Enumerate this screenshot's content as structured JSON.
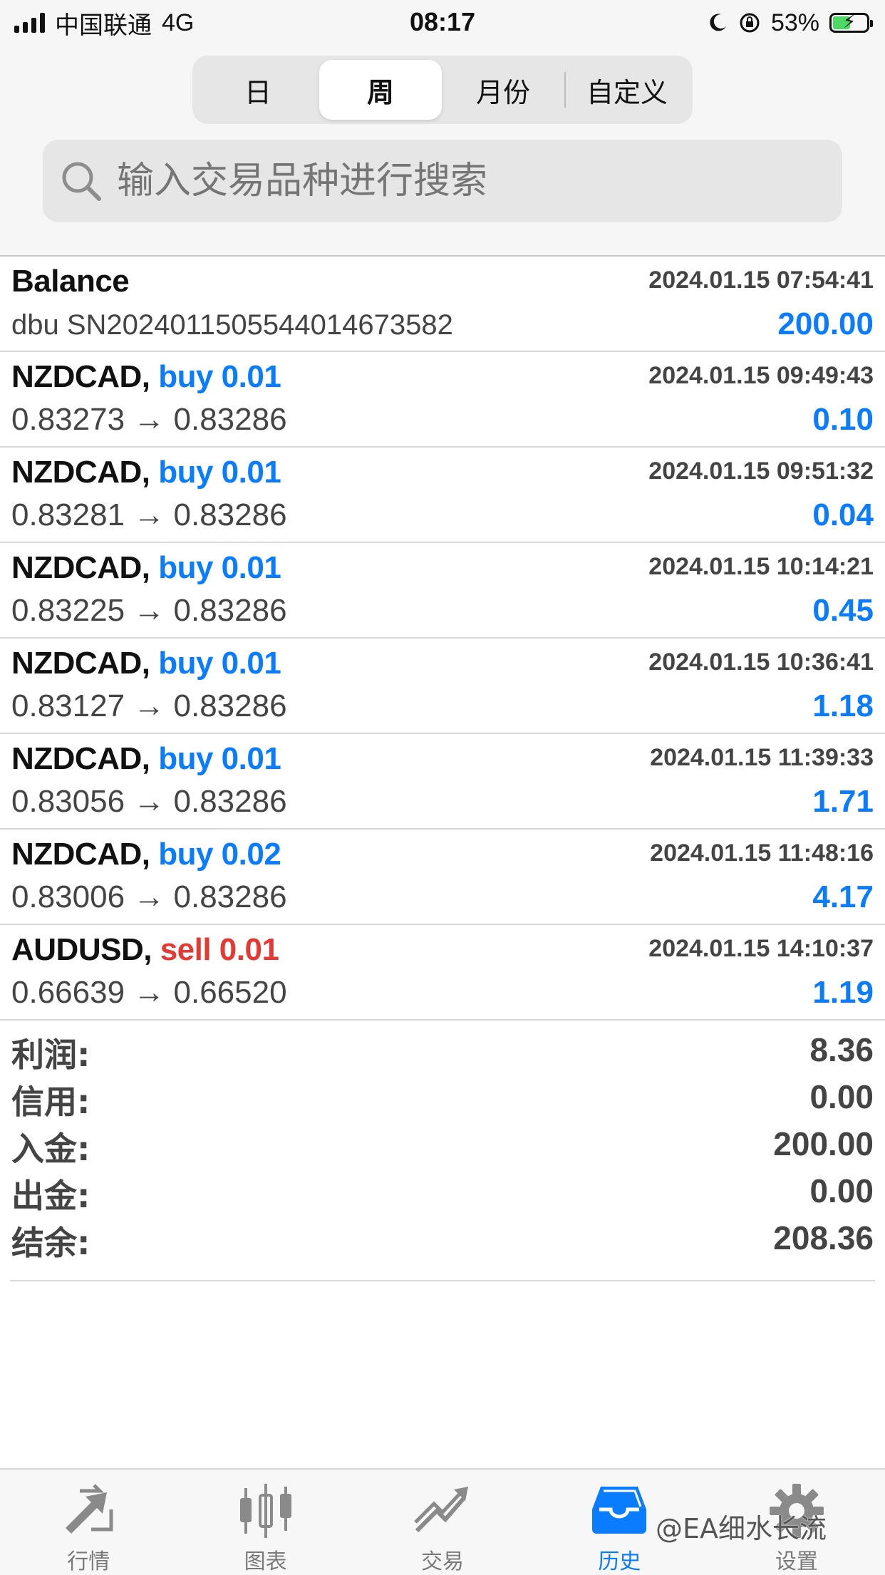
{
  "status_bar": {
    "carrier": "中国联通",
    "network": "4G",
    "time": "08:17",
    "battery": "53%",
    "battery_level": 0.53
  },
  "segments": {
    "items": [
      "日",
      "周",
      "月份",
      "自定义"
    ],
    "selected": "周"
  },
  "search": {
    "placeholder": "输入交易品种进行搜索"
  },
  "balance_row": {
    "title": "Balance",
    "time": "2024.01.15 07:54:41",
    "comment": "dbu SN20240115055440146735​82",
    "amount": "200.00"
  },
  "trades": [
    {
      "symbol": "NZDCAD,",
      "side": "buy 0.01",
      "time": "2024.01.15 09:49:43",
      "prices": "0.83273 → 0.83286",
      "profit": "0.10"
    },
    {
      "symbol": "NZDCAD,",
      "side": "buy 0.01",
      "time": "2024.01.15 09:51:32",
      "prices": "0.83281 → 0.83286",
      "profit": "0.04"
    },
    {
      "symbol": "NZDCAD,",
      "side": "buy 0.01",
      "time": "2024.01.15 10:14:21",
      "prices": "0.83225 → 0.83286",
      "profit": "0.45"
    },
    {
      "symbol": "NZDCAD,",
      "side": "buy 0.01",
      "time": "2024.01.15 10:36:41",
      "prices": "0.83127 → 0.83286",
      "profit": "1.18"
    },
    {
      "symbol": "NZDCAD,",
      "side": "buy 0.01",
      "time": "2024.01.15 11:39:33",
      "prices": "0.83056 → 0.83286",
      "profit": "1.71"
    },
    {
      "symbol": "NZDCAD,",
      "side": "buy 0.02",
      "time": "2024.01.15 11:48:16",
      "prices": "0.83006 → 0.83286",
      "profit": "4.17"
    },
    {
      "symbol": "AUDUSD,",
      "side": "sell 0.01",
      "time": "2024.01.15 14:10:37",
      "prices": "0.66639 → 0.66520",
      "profit": "1.19"
    }
  ],
  "summary": {
    "profit_label": "利润:",
    "profit": "8.36",
    "credit_label": "信用:",
    "credit": "0.00",
    "deposit_label": "入金:",
    "deposit": "200.00",
    "withdrawal_label": "出金:",
    "withdrawal": "0.00",
    "balance_label": "结余:",
    "balance": "208.36"
  },
  "tabs": {
    "quotes": "行情",
    "charts": "图表",
    "trade": "交易",
    "history": "历史",
    "settings": "设置"
  },
  "watermark": "@EA细水长流",
  "colors": {
    "accent": "#0a7cff",
    "sell": "#e53935",
    "buy": "#0a7cff"
  }
}
